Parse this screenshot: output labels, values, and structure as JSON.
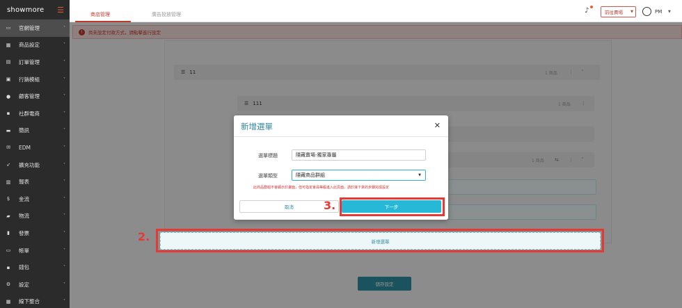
{
  "sidebar": {
    "brand": "showmore",
    "items": [
      {
        "icon": "laptop-icon",
        "glyph": "▭",
        "label": "官網管理",
        "active": true
      },
      {
        "icon": "store-icon",
        "glyph": "▦",
        "label": "商品設定"
      },
      {
        "icon": "document-icon",
        "glyph": "▤",
        "label": "訂單管理"
      },
      {
        "icon": "gift-icon",
        "glyph": "▣",
        "label": "行銷模組"
      },
      {
        "icon": "user-icon",
        "glyph": "●",
        "label": "顧客管理"
      },
      {
        "icon": "briefcase-icon",
        "glyph": "▪",
        "label": "社群電商"
      },
      {
        "icon": "chat-icon",
        "glyph": "▬",
        "label": "簡訊"
      },
      {
        "icon": "mail-icon",
        "glyph": "✉",
        "label": "EDM"
      },
      {
        "icon": "rocket-icon",
        "glyph": "➶",
        "label": "擴充功能"
      },
      {
        "icon": "chart-icon",
        "glyph": "▥",
        "label": "報表"
      },
      {
        "icon": "money-icon",
        "glyph": "$",
        "label": "金流"
      },
      {
        "icon": "truck-icon",
        "glyph": "▰",
        "label": "物流"
      },
      {
        "icon": "invoice-icon",
        "glyph": "▮",
        "label": "發票"
      },
      {
        "icon": "card-icon",
        "glyph": "▭",
        "label": "帳單"
      },
      {
        "icon": "wallet-icon",
        "glyph": "▪",
        "label": "錢包"
      },
      {
        "icon": "gear-icon",
        "glyph": "⚙",
        "label": "設定"
      },
      {
        "icon": "integration-icon",
        "glyph": "▦",
        "label": "線下整合"
      }
    ]
  },
  "topbar": {
    "tabs": [
      "商店管理",
      "廣告投放管理"
    ],
    "store_button": "前往賣場",
    "user": "PM"
  },
  "alert": {
    "text": "尚未設定付款方式，請點擊進行設定"
  },
  "content": {
    "rows": [
      {
        "name": "11",
        "count": "1 商品"
      },
      {
        "name": "111",
        "count": "1 商品"
      },
      {
        "name": "",
        "count": "1 商品"
      }
    ],
    "add_menu_button": "新增選單",
    "save_button": "儲存設定",
    "step2": "2."
  },
  "modal": {
    "title": "新增選單",
    "label_title": "選單標題",
    "value_title": "隱藏賣場-獨家專屬",
    "label_type": "選單類型",
    "value_type": "隱藏商品群組",
    "warning": "此商品群組不會顯示於畫面，但可指定會員等級進入此頁面，請於接下來的步驟完成設定",
    "cancel": "取消",
    "next": "下一步",
    "step3": "3."
  }
}
